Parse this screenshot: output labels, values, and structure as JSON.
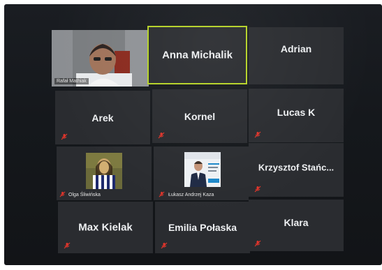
{
  "participants": {
    "p1": {
      "name": "Rafał Mathiak"
    },
    "p2": {
      "name": "Anna Michalik"
    },
    "p3": {
      "name": "Adrian"
    },
    "p4": {
      "name": "Arek"
    },
    "p5": {
      "name": "Kornel"
    },
    "p6": {
      "name": "Lucas K"
    },
    "p7": {
      "name": "Olga Śliwińska"
    },
    "p8": {
      "name": "Łukasz Andrzej Kaza"
    },
    "p9": {
      "name": "Krzysztof  Stańc..."
    },
    "p10": {
      "name": "Max Kielak"
    },
    "p11": {
      "name": "Emilia Połaska"
    },
    "p12": {
      "name": "Klara"
    }
  },
  "colors": {
    "active_speaker_border": "#b5d226",
    "muted_icon": "#e0352b",
    "tile_background": "#2a2c30"
  },
  "icons": {
    "muted": "microphone-muted-icon"
  }
}
